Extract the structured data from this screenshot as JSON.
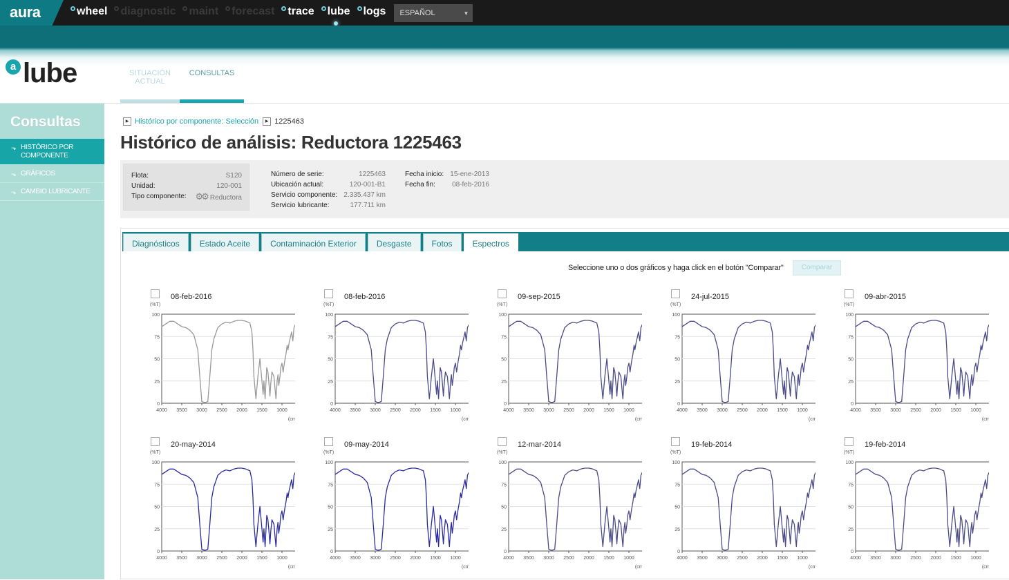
{
  "topnav": {
    "brand": "aura",
    "items": [
      {
        "label": "wheel",
        "enabled": true,
        "current": false
      },
      {
        "label": "diagnostic",
        "enabled": false,
        "current": false
      },
      {
        "label": "maint",
        "enabled": false,
        "current": false
      },
      {
        "label": "forecast",
        "enabled": false,
        "current": false
      },
      {
        "label": "trace",
        "enabled": true,
        "current": false
      },
      {
        "label": "lube",
        "enabled": true,
        "current": true
      },
      {
        "label": "logs",
        "enabled": true,
        "current": false
      }
    ],
    "language": "ESPAÑOL"
  },
  "logo": {
    "icon": "a",
    "text": "lube"
  },
  "module_tabs": [
    {
      "label": "SITUACIÓN ACTUAL",
      "active": false
    },
    {
      "label": "CONSULTAS",
      "active": true
    }
  ],
  "sidebar": {
    "title": "Consultas",
    "items": [
      {
        "label": "HISTÓRICO POR COMPONENTE",
        "active": true
      },
      {
        "label": "GRÁFICOS",
        "active": false
      },
      {
        "label": "CAMBIO LUBRICANTE",
        "active": false
      }
    ]
  },
  "breadcrumb": {
    "link": "Histórico por componente: Selección",
    "current": "1225463"
  },
  "page_title": "Histórico de análisis: Reductora 1225463",
  "info": {
    "flota_label": "Flota:",
    "flota_value": "S120",
    "unidad_label": "Unidad:",
    "unidad_value": "120-001",
    "tipo_label": "Tipo componente:",
    "tipo_value": "Reductora",
    "serie_label": "Número de serie:",
    "serie_value": "1225463",
    "ubicacion_label": "Ubicación actual:",
    "ubicacion_value": "120-001-B1",
    "servicio_comp_label": "Servicio componente:",
    "servicio_comp_value": "2.335.437 km",
    "servicio_lub_label": "Servicio lubricante:",
    "servicio_lub_value": "177.711 km",
    "fecha_inicio_label": "Fecha inicio:",
    "fecha_inicio_value": "15-ene-2013",
    "fecha_fin_label": "Fecha fin:",
    "fecha_fin_value": "08-feb-2016"
  },
  "tabs": [
    {
      "label": "Diagnósticos",
      "active": false
    },
    {
      "label": "Estado Aceite",
      "active": false
    },
    {
      "label": "Contaminación Exterior",
      "active": false
    },
    {
      "label": "Desgaste",
      "active": false
    },
    {
      "label": "Fotos",
      "active": false
    },
    {
      "label": "Espectros",
      "active": true
    }
  ],
  "compare": {
    "hint": "Seleccione uno o dos gráficos y haga click en el botón \"Comparar\"",
    "button": "Comparar"
  },
  "chart_data": {
    "type": "line",
    "y_unit": "(%T)",
    "x_unit": "(cm-1)",
    "x_ticks": [
      "4000",
      "3500",
      "3000",
      "2500",
      "2000",
      "1500",
      "1000",
      "500"
    ],
    "y_ticks": [
      "0",
      "25",
      "50",
      "75",
      "100"
    ],
    "xlim": [
      4000,
      500
    ],
    "ylim": [
      0,
      100
    ],
    "x": [
      4000,
      3900,
      3800,
      3700,
      3600,
      3500,
      3400,
      3300,
      3200,
      3100,
      3050,
      3000,
      2950,
      2900,
      2850,
      2800,
      2750,
      2700,
      2600,
      2500,
      2400,
      2300,
      2200,
      2100,
      2000,
      1900,
      1800,
      1750,
      1725,
      1700,
      1650,
      1600,
      1550,
      1500,
      1470,
      1450,
      1420,
      1380,
      1350,
      1320,
      1300,
      1280,
      1250,
      1200,
      1170,
      1150,
      1120,
      1100,
      1080,
      1050,
      1030,
      1000,
      970,
      950,
      920,
      900,
      870,
      850,
      820,
      800,
      760,
      730,
      700,
      650,
      600,
      550,
      500
    ],
    "series": [
      {
        "values": [
          86,
          89,
          92,
          92,
          89,
          86,
          85,
          82,
          77,
          60,
          30,
          2,
          1,
          1,
          2,
          30,
          60,
          72,
          85,
          89,
          91,
          90,
          92,
          93,
          93,
          92,
          90,
          80,
          60,
          30,
          5,
          30,
          50,
          25,
          10,
          25,
          5,
          40,
          35,
          20,
          8,
          22,
          35,
          30,
          15,
          5,
          25,
          32,
          20,
          30,
          40,
          45,
          35,
          42,
          50,
          55,
          65,
          60,
          68,
          72,
          80,
          70,
          85,
          90,
          80,
          86,
          82
        ]
      },
      {
        "values": [
          86,
          89,
          92,
          92,
          89,
          86,
          85,
          82,
          77,
          60,
          30,
          2,
          1,
          1,
          2,
          30,
          60,
          72,
          85,
          89,
          91,
          90,
          92,
          93,
          93,
          92,
          90,
          80,
          60,
          30,
          5,
          30,
          50,
          25,
          10,
          25,
          5,
          40,
          35,
          20,
          8,
          22,
          35,
          30,
          15,
          5,
          25,
          32,
          20,
          30,
          40,
          45,
          35,
          42,
          50,
          55,
          65,
          60,
          68,
          72,
          80,
          70,
          85,
          90,
          80,
          86,
          82
        ]
      },
      {
        "values": [
          86,
          89,
          92,
          92,
          89,
          86,
          85,
          82,
          77,
          60,
          30,
          2,
          1,
          1,
          2,
          30,
          60,
          72,
          85,
          89,
          91,
          90,
          92,
          93,
          93,
          92,
          90,
          80,
          60,
          30,
          5,
          30,
          50,
          25,
          10,
          25,
          5,
          40,
          35,
          20,
          8,
          22,
          35,
          30,
          15,
          5,
          25,
          32,
          20,
          30,
          40,
          45,
          35,
          42,
          50,
          55,
          65,
          60,
          68,
          72,
          80,
          70,
          85,
          90,
          80,
          86,
          82
        ]
      },
      {
        "values": [
          86,
          89,
          92,
          92,
          89,
          86,
          85,
          82,
          77,
          60,
          30,
          2,
          1,
          1,
          2,
          30,
          60,
          72,
          85,
          89,
          91,
          90,
          92,
          93,
          93,
          92,
          90,
          80,
          60,
          30,
          5,
          30,
          50,
          25,
          10,
          25,
          5,
          40,
          35,
          20,
          8,
          22,
          35,
          30,
          15,
          5,
          25,
          32,
          20,
          30,
          40,
          45,
          35,
          42,
          50,
          55,
          65,
          60,
          68,
          72,
          80,
          70,
          85,
          90,
          80,
          86,
          82
        ]
      },
      {
        "values": [
          86,
          89,
          92,
          92,
          89,
          86,
          85,
          82,
          77,
          60,
          30,
          2,
          1,
          1,
          2,
          30,
          60,
          72,
          85,
          89,
          91,
          90,
          92,
          93,
          93,
          92,
          90,
          80,
          60,
          30,
          5,
          30,
          50,
          25,
          10,
          25,
          5,
          40,
          35,
          20,
          8,
          22,
          35,
          30,
          15,
          5,
          25,
          32,
          20,
          30,
          40,
          45,
          35,
          42,
          50,
          55,
          65,
          60,
          68,
          72,
          80,
          70,
          85,
          90,
          80,
          86,
          82
        ]
      },
      {
        "values": [
          86,
          89,
          92,
          92,
          89,
          86,
          85,
          82,
          77,
          60,
          30,
          2,
          1,
          1,
          2,
          30,
          60,
          72,
          85,
          89,
          91,
          90,
          92,
          93,
          93,
          92,
          90,
          80,
          60,
          30,
          5,
          30,
          50,
          25,
          10,
          25,
          5,
          40,
          35,
          20,
          8,
          22,
          35,
          30,
          15,
          5,
          25,
          32,
          20,
          30,
          40,
          45,
          35,
          42,
          50,
          55,
          65,
          60,
          68,
          72,
          80,
          70,
          85,
          90,
          80,
          86,
          82
        ]
      },
      {
        "values": [
          86,
          89,
          92,
          92,
          89,
          86,
          85,
          82,
          77,
          60,
          30,
          2,
          1,
          1,
          2,
          30,
          60,
          72,
          85,
          89,
          91,
          90,
          92,
          93,
          93,
          92,
          90,
          80,
          60,
          30,
          5,
          30,
          50,
          25,
          10,
          25,
          5,
          40,
          35,
          20,
          8,
          22,
          35,
          30,
          15,
          5,
          25,
          32,
          20,
          30,
          40,
          45,
          35,
          42,
          50,
          55,
          65,
          60,
          68,
          72,
          80,
          70,
          85,
          90,
          80,
          86,
          82
        ]
      },
      {
        "values": [
          86,
          89,
          92,
          92,
          89,
          86,
          85,
          82,
          77,
          60,
          30,
          2,
          1,
          1,
          2,
          30,
          60,
          72,
          85,
          89,
          91,
          90,
          92,
          93,
          93,
          92,
          90,
          80,
          60,
          30,
          5,
          30,
          50,
          25,
          10,
          25,
          5,
          40,
          35,
          20,
          8,
          22,
          35,
          30,
          15,
          5,
          25,
          32,
          20,
          30,
          40,
          45,
          35,
          42,
          50,
          55,
          65,
          60,
          68,
          72,
          80,
          70,
          85,
          90,
          80,
          86,
          82
        ]
      },
      {
        "values": [
          86,
          89,
          92,
          92,
          89,
          86,
          85,
          82,
          77,
          60,
          30,
          2,
          1,
          1,
          2,
          30,
          60,
          72,
          85,
          89,
          91,
          90,
          92,
          93,
          93,
          92,
          90,
          80,
          60,
          30,
          5,
          30,
          50,
          25,
          10,
          25,
          5,
          40,
          35,
          20,
          8,
          22,
          35,
          30,
          15,
          5,
          25,
          32,
          20,
          30,
          40,
          45,
          35,
          42,
          50,
          55,
          65,
          60,
          68,
          72,
          80,
          70,
          85,
          90,
          80,
          86,
          82
        ]
      },
      {
        "values": [
          86,
          89,
          92,
          92,
          89,
          86,
          85,
          82,
          77,
          60,
          30,
          2,
          1,
          1,
          2,
          30,
          60,
          72,
          85,
          89,
          91,
          90,
          92,
          93,
          93,
          92,
          90,
          80,
          60,
          30,
          5,
          30,
          50,
          25,
          10,
          25,
          5,
          40,
          35,
          20,
          8,
          22,
          35,
          30,
          15,
          5,
          25,
          32,
          20,
          30,
          40,
          45,
          35,
          42,
          50,
          55,
          65,
          60,
          68,
          72,
          80,
          70,
          85,
          90,
          80,
          86,
          82
        ]
      }
    ],
    "spectra": [
      {
        "date": "08-feb-2016",
        "color": "#999999"
      },
      {
        "date": "08-feb-2016",
        "color": "#4a4a8a"
      },
      {
        "date": "09-sep-2015",
        "color": "#4a4a8a"
      },
      {
        "date": "24-jul-2015",
        "color": "#4a4a8a"
      },
      {
        "date": "09-abr-2015",
        "color": "#4a4a8a"
      },
      {
        "date": "20-may-2014",
        "color": "#2a2aa0"
      },
      {
        "date": "09-may-2014",
        "color": "#2a2aa0"
      },
      {
        "date": "12-mar-2014",
        "color": "#4a4a8a"
      },
      {
        "date": "19-feb-2014",
        "color": "#4a4a8a"
      },
      {
        "date": "19-feb-2014",
        "color": "#4a4a8a"
      }
    ]
  }
}
